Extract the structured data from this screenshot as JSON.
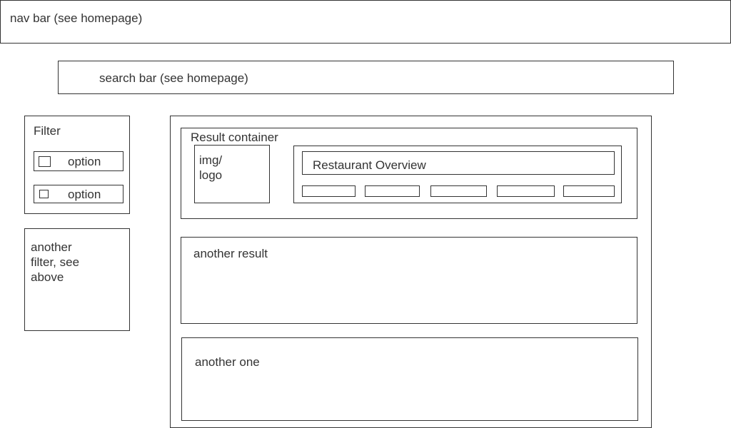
{
  "nav": {
    "label": "nav bar (see homepage)"
  },
  "search": {
    "label": "search bar (see homepage)"
  },
  "filter": {
    "title": "Filter",
    "options": [
      {
        "label": "option"
      },
      {
        "label": "option"
      }
    ]
  },
  "another_filter": {
    "label": "another\nfilter, see\nabove"
  },
  "results": {
    "container_label": "Result container",
    "img_label": "img/\nlogo",
    "overview_label": "Restaurant Overview",
    "another_result": "another result",
    "another_one": "another one"
  }
}
